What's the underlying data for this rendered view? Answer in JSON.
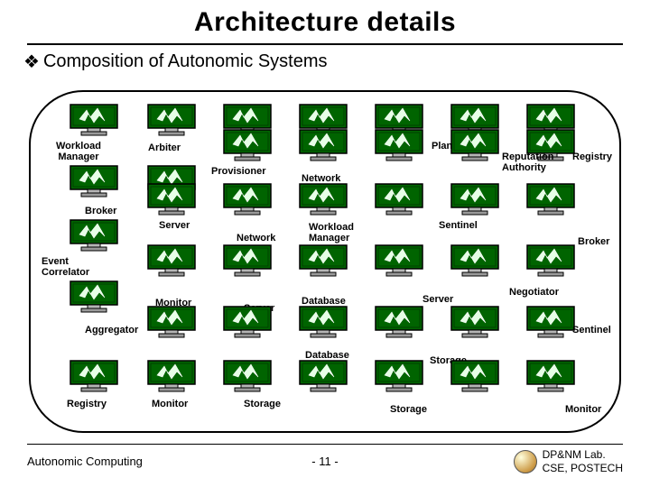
{
  "title": "Architecture details",
  "subtitle": "Composition of Autonomic Systems",
  "nodes": {
    "workload_manager_1": "Workload\nManager",
    "arbiter": "Arbiter",
    "provisioner": "Provisioner",
    "planner": "Planner",
    "network_1": "Network",
    "reputation_authority": "Reputation\nAuthority",
    "registry_1": "Registry",
    "broker_1": "Broker",
    "server_1": "Server",
    "network_2": "Network",
    "workload_manager_2": "Workload\nManager",
    "sentinel_1": "Sentinel",
    "broker_2": "Broker",
    "event_correlator": "Event\nCorrelator",
    "monitor_1": "Monitor",
    "server_2": "Server",
    "database_1": "Database",
    "server_3": "Server",
    "negotiator": "Negotiator",
    "aggregator": "Aggregator",
    "database_2": "Database",
    "sentinel_2": "Sentinel",
    "storage_1": "Storage",
    "registry_2": "Registry",
    "monitor_2": "Monitor",
    "storage_2": "Storage",
    "storage_3": "Storage",
    "monitor_3": "Monitor"
  },
  "footer": {
    "left": "Autonomic Computing",
    "page": "- 11 -",
    "lab1": "DP&NM Lab.",
    "lab2": "CSE, POSTECH"
  }
}
